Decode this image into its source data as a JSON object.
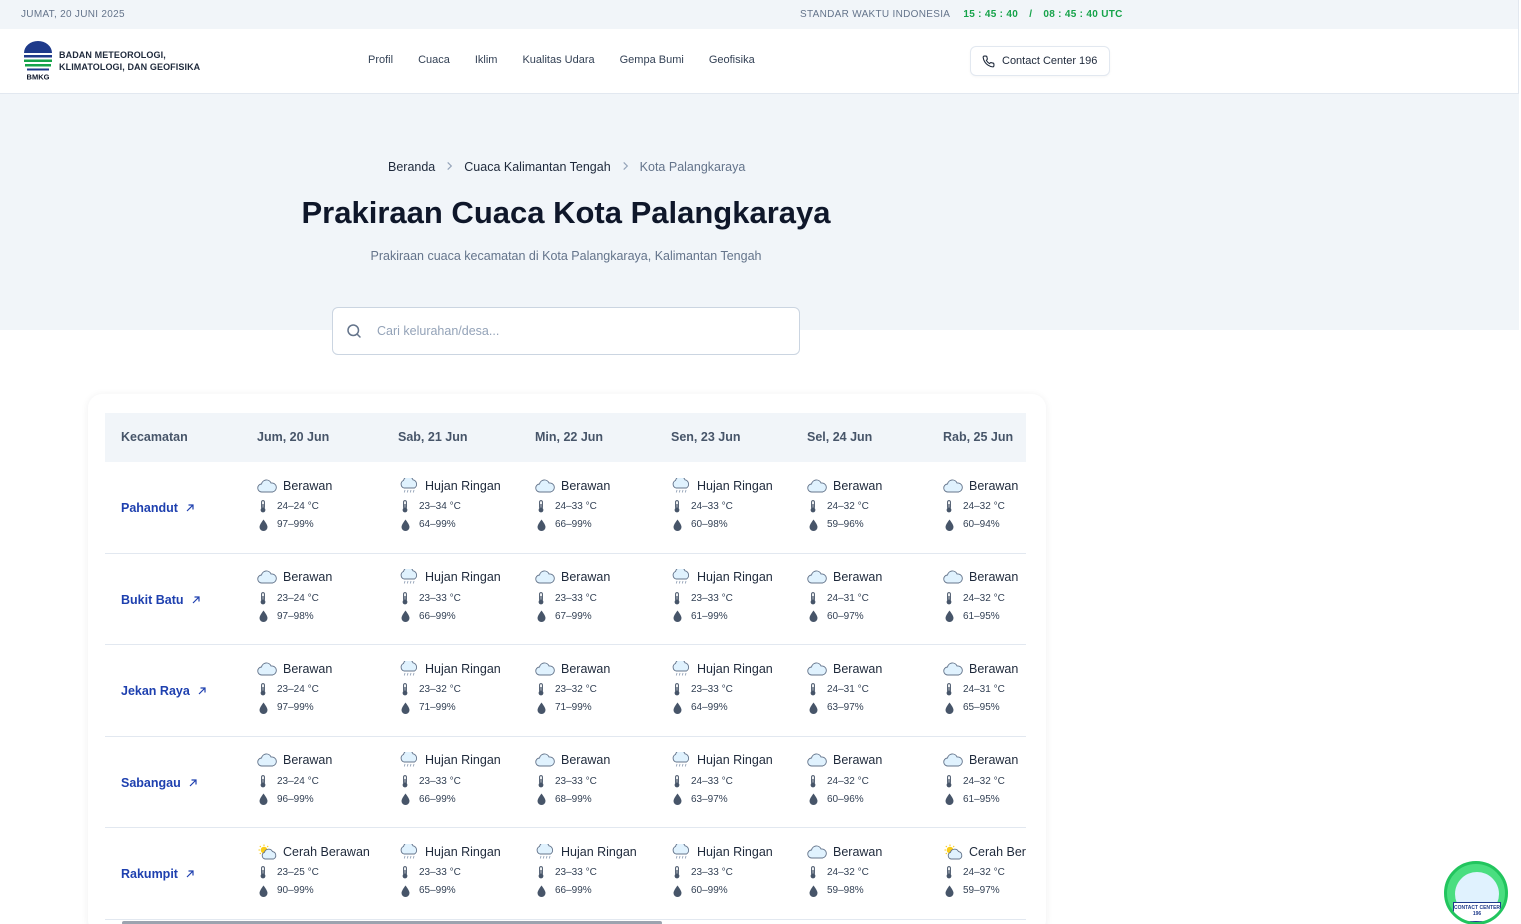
{
  "topbar": {
    "date": "JUMAT, 20 JUNI 2025",
    "time_label": "STANDAR WAKTU INDONESIA",
    "local_time": "15 : 45 : 40",
    "separator": "/",
    "utc_time": "08 : 45 : 40 UTC"
  },
  "header": {
    "logo_text": "BMKG",
    "org_line1": "BADAN METEOROLOGI,",
    "org_line2": "KLIMATOLOGI, DAN GEOFISIKA",
    "nav": [
      "Profil",
      "Cuaca",
      "Iklim",
      "Kualitas Udara",
      "Gempa Bumi",
      "Geofisika"
    ],
    "contact": "Contact Center 196"
  },
  "breadcrumb": [
    "Beranda",
    "Cuaca Kalimantan Tengah",
    "Kota Palangkaraya"
  ],
  "title": "Prakiraan Cuaca Kota Palangkaraya",
  "subtitle": "Prakiraan cuaca kecamatan di Kota Palangkaraya, Kalimantan Tengah",
  "search": {
    "placeholder": "Cari kelurahan/desa..."
  },
  "table": {
    "headers": [
      "Kecamatan",
      "Jum, 20 Jun",
      "Sab, 21 Jun",
      "Min, 22 Jun",
      "Sen, 23 Jun",
      "Sel, 24 Jun",
      "Rab, 25 Jun"
    ],
    "rows": [
      {
        "name": "Pahandut",
        "days": [
          {
            "cond": "Berawan",
            "icon": "cloud-icon",
            "temp": "24–24 °C",
            "hum": "97–99%"
          },
          {
            "cond": "Hujan Ringan",
            "icon": "rain-cloud-icon",
            "temp": "23–34 °C",
            "hum": "64–99%"
          },
          {
            "cond": "Berawan",
            "icon": "cloud-icon",
            "temp": "24–33 °C",
            "hum": "66–99%"
          },
          {
            "cond": "Hujan Ringan",
            "icon": "rain-cloud-icon",
            "temp": "24–33 °C",
            "hum": "60–98%"
          },
          {
            "cond": "Berawan",
            "icon": "cloud-icon",
            "temp": "24–32 °C",
            "hum": "59–96%"
          },
          {
            "cond": "Berawan",
            "icon": "cloud-icon",
            "temp": "24–32 °C",
            "hum": "60–94%"
          }
        ]
      },
      {
        "name": "Bukit Batu",
        "days": [
          {
            "cond": "Berawan",
            "icon": "cloud-icon",
            "temp": "23–24 °C",
            "hum": "97–98%"
          },
          {
            "cond": "Hujan Ringan",
            "icon": "rain-cloud-icon",
            "temp": "23–33 °C",
            "hum": "66–99%"
          },
          {
            "cond": "Berawan",
            "icon": "cloud-icon",
            "temp": "23–33 °C",
            "hum": "67–99%"
          },
          {
            "cond": "Hujan Ringan",
            "icon": "rain-cloud-icon",
            "temp": "23–33 °C",
            "hum": "61–99%"
          },
          {
            "cond": "Berawan",
            "icon": "cloud-icon",
            "temp": "24–31 °C",
            "hum": "60–97%"
          },
          {
            "cond": "Berawan",
            "icon": "cloud-icon",
            "temp": "24–32 °C",
            "hum": "61–95%"
          }
        ]
      },
      {
        "name": "Jekan Raya",
        "days": [
          {
            "cond": "Berawan",
            "icon": "cloud-icon",
            "temp": "23–24 °C",
            "hum": "97–99%"
          },
          {
            "cond": "Hujan Ringan",
            "icon": "rain-cloud-icon",
            "temp": "23–32 °C",
            "hum": "71–99%"
          },
          {
            "cond": "Berawan",
            "icon": "cloud-icon",
            "temp": "23–32 °C",
            "hum": "71–99%"
          },
          {
            "cond": "Hujan Ringan",
            "icon": "rain-cloud-icon",
            "temp": "23–33 °C",
            "hum": "64–99%"
          },
          {
            "cond": "Berawan",
            "icon": "cloud-icon",
            "temp": "24–31 °C",
            "hum": "63–97%"
          },
          {
            "cond": "Berawan",
            "icon": "cloud-icon",
            "temp": "24–31 °C",
            "hum": "65–95%"
          }
        ]
      },
      {
        "name": "Sabangau",
        "days": [
          {
            "cond": "Berawan",
            "icon": "cloud-icon",
            "temp": "23–24 °C",
            "hum": "96–99%"
          },
          {
            "cond": "Hujan Ringan",
            "icon": "rain-cloud-icon",
            "temp": "23–33 °C",
            "hum": "66–99%"
          },
          {
            "cond": "Berawan",
            "icon": "cloud-icon",
            "temp": "23–33 °C",
            "hum": "68–99%"
          },
          {
            "cond": "Hujan Ringan",
            "icon": "rain-cloud-icon",
            "temp": "24–33 °C",
            "hum": "63–97%"
          },
          {
            "cond": "Berawan",
            "icon": "cloud-icon",
            "temp": "24–32 °C",
            "hum": "60–96%"
          },
          {
            "cond": "Berawan",
            "icon": "cloud-icon",
            "temp": "24–32 °C",
            "hum": "61–95%"
          }
        ]
      },
      {
        "name": "Rakumpit",
        "days": [
          {
            "cond": "Cerah Berawan",
            "icon": "sun-cloud-icon",
            "temp": "23–25 °C",
            "hum": "90–99%"
          },
          {
            "cond": "Hujan Ringan",
            "icon": "rain-cloud-icon",
            "temp": "23–33 °C",
            "hum": "65–99%"
          },
          {
            "cond": "Hujan Ringan",
            "icon": "rain-cloud-icon",
            "temp": "23–33 °C",
            "hum": "66–99%"
          },
          {
            "cond": "Hujan Ringan",
            "icon": "rain-cloud-icon",
            "temp": "23–33 °C",
            "hum": "60–99%"
          },
          {
            "cond": "Berawan",
            "icon": "cloud-icon",
            "temp": "24–32 °C",
            "hum": "59–98%"
          },
          {
            "cond": "Cerah Berawan",
            "icon": "sun-cloud-icon",
            "temp": "24–32 °C",
            "hum": "59–97%"
          }
        ]
      }
    ]
  },
  "floating_button": {
    "line1": "CONTACT CENTER",
    "line2": "196"
  },
  "colors": {
    "accent_green": "#16a34a",
    "link_blue": "#1e40af",
    "hero_bg": "#f1f5f9"
  }
}
